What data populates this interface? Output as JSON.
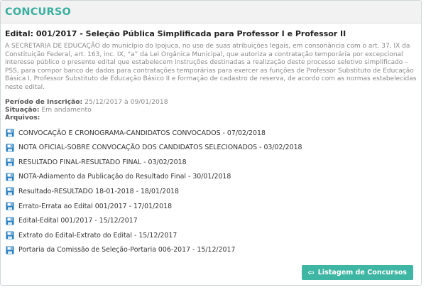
{
  "panel": {
    "title": "CONCURSO"
  },
  "edital": {
    "title": "Edital:  001/2017  -  Seleção Pública Simplificada para Professor I e Professor II",
    "description": "A SECRETARIA DE EDUCAÇÃO do município do Ipojuca, no uso de suas atribuições legais, em consonância com o art. 37, IX da Constituição Federal, art. 163, inc. IX, “a” da Lei Orgânica Municipal, que autoriza a contratação temporária por excepcional interesse público o presente edital que estabelecem instruções destinadas a realização deste processo seletivo simplificado – PSS, para compor banco de dados para contratações temporárias para exercer as funções de Professor Substituto de Educação Básica I, Professor Substituto de Educação Básico II e formação de cadastro de reserva, de acordo com as normas estabelecidas neste edital."
  },
  "meta": {
    "periodo_label": "Período de Inscrição:",
    "periodo_value": "25/12/2017 à 09/01/2018",
    "situacao_label": "Situação:",
    "situacao_value": "Em andamento",
    "arquivos_label": "Arquivos:"
  },
  "files": [
    "CONVOCAÇÃO E CRONOGRAMA-CANDIDATOS CONVOCADOS  -  07/02/2018",
    "NOTA OFICIAL-SOBRE CONVOCAÇÃO DOS CANDIDATOS SELECIONADOS  -  03/02/2018",
    "RESULTADO FINAL-RESULTADO FINAL  -  03/02/2018",
    "NOTA-Adiamento da Publicação do Resultado Final  -  30/01/2018",
    "Resultado-RESULTADO 18-01-2018  -  18/01/2018",
    "Errato-Errata ao Edital 001/2017  -  17/01/2018",
    "Edital-Edital 001/2017  -  15/12/2017",
    "Extrato do Edital-Extrato do Edital  -  15/12/2017",
    "Portaria da Comissão de Seleção-Portaria 006-2017  -  15/12/2017"
  ],
  "button": {
    "label": "Listagem de Concursos"
  },
  "colors": {
    "accent": "#3fb6a4",
    "title": "#3aaf9f",
    "file_icon": "#2a7fc1"
  }
}
